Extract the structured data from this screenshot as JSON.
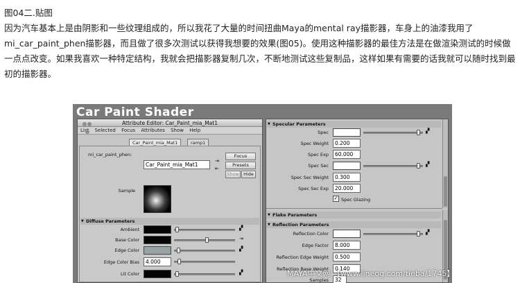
{
  "article": {
    "caption": "图04二.贴图",
    "paragraph1": "因为汽车基本上是由阴影和一些纹理组成的，所以我花了大量的时间扭曲Maya的mental ray描影器，车身上的油漆我用了mi_car_paint_phen描影器，而且做了很多次测试以获得我想要的效果(图05)。使用这种描影器的最佳方法是在做渲染测试的时候做一点点改变。如果我喜欢一种特定结构，我就会把描影器复制几次，不断地测试这些复制品，这样如果有需要的话我就可以随时找到最初的描影器。"
  },
  "screenshot": {
    "banner_title": "Car Paint Shader",
    "editor": {
      "title": "Attribute Editor: Car_Paint_mia_Mat1",
      "menu": [
        "List",
        "Selected",
        "Focus",
        "Attributes",
        "Show",
        "Help"
      ],
      "tabs": [
        "Car_Paint_mia_Mat1",
        "ramp1"
      ],
      "node_type_label": "mi_car_paint_phen:",
      "node_name_value": "Car_Paint_mia_Mat1",
      "focus_button": "Focus",
      "presets_button": "Presets",
      "show_button": "Show",
      "hide_button": "Hide",
      "sample_label": "Sample",
      "diffuse_section": "Diffuse Parameters",
      "ambient_label": "Ambient",
      "base_color_label": "Base Color",
      "edge_color_label": "Edge Color",
      "edge_color_bias_label": "Edge Color Bias",
      "edge_color_bias_value": "4.000",
      "lit_color_label": "Lit Color",
      "ambient_slider": 0.02,
      "base_color_slider": 0.55,
      "edge_color_slider": 0.05,
      "lit_color_slider": 0.03
    },
    "right_panel": {
      "specular_section": "Specular Parameters",
      "spec_label": "Spec",
      "spec_slider": 0.96,
      "spec_weight_label": "Spec Weight",
      "spec_weight_value": "0.200",
      "spec_exp_label": "Spec Exp",
      "spec_exp_value": "60.000",
      "spec_sec_label": "Spec Sec",
      "spec_sec_slider": 0.96,
      "spec_sec_weight_label": "Spec Sec Weight",
      "spec_sec_weight_value": "0.300",
      "spec_sec_exp_label": "Spec Sec Exp",
      "spec_sec_exp_value": "20.000",
      "spec_glazing_label": "Spec Glazing",
      "flake_section": "Flake Parameters",
      "reflection_section": "Reflection Parameters",
      "reflection_color_label": "Reflection Color",
      "reflection_color_slider": 0.96,
      "edge_factor_label": "Edge Factor",
      "edge_factor_value": "8.000",
      "reflection_edge_weight_label": "Reflection Edge Weight",
      "reflection_edge_weight_value": "0.500",
      "reflection_base_weight_label": "Reflection Base Weight",
      "reflection_base_weight_value": "0.140",
      "samples_label": "Samples",
      "samples_value": "32"
    },
    "watermark": "MAYA中文网 【www.lineog.com/tieba/1745】"
  },
  "colors": {
    "ambient_swatch": "#050505",
    "base_color_swatch": "#060606",
    "edge_color_swatch": "#9aa3a3",
    "lit_color_swatch": "#050505",
    "spec_swatch": "#ffffff",
    "spec_sec_swatch": "#ffffff",
    "reflection_color_swatch": "#ffffff"
  }
}
